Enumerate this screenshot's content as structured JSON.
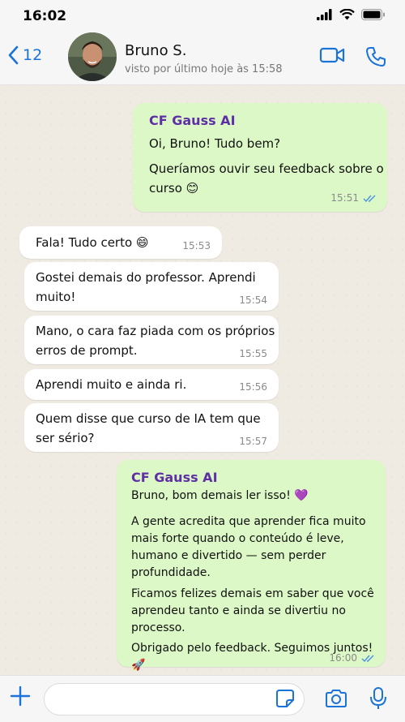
{
  "status_bar": {
    "time": "16:02"
  },
  "header": {
    "back_count": "12",
    "contact_name": "Bruno S.",
    "last_seen": "visto por último hoje às 15:58"
  },
  "messages": [
    {
      "direction": "out",
      "sender": "CF Gauss AI",
      "lines": [
        "Oi, Bruno! Tudo bem?",
        "Queríamos ouvir seu feedback sobre o",
        "curso 😊"
      ],
      "time": "15:51",
      "read": true
    },
    {
      "direction": "in",
      "lines": [
        "Fala! Tudo certo 😄"
      ],
      "time": "15:53"
    },
    {
      "direction": "in",
      "lines": [
        "Gostei demais do professor. Aprendi",
        "muito!"
      ],
      "time": "15:54"
    },
    {
      "direction": "in",
      "lines": [
        "Mano, o cara faz piada com os próprios",
        "erros de prompt."
      ],
      "time": "15:55"
    },
    {
      "direction": "in",
      "lines": [
        "Aprendi muito e ainda ri."
      ],
      "time": "15:56"
    },
    {
      "direction": "in",
      "lines": [
        "Quem disse que curso de IA tem que",
        "ser sério?"
      ],
      "time": "15:57"
    },
    {
      "direction": "out",
      "sender": "CF Gauss AI",
      "lines": [
        "Bruno, bom demais ler isso! 💜",
        "A gente acredita que aprender fica muito",
        "mais forte quando o conteúdo é leve,",
        "humano e divertido — sem perder",
        "profundidade.",
        "Ficamos felizes demais em saber que você",
        "aprendeu tanto e ainda se divertiu no",
        "processo.",
        "Obrigado pelo feedback. Seguimos juntos! 🚀"
      ],
      "time": "16:00",
      "read": true
    }
  ],
  "icons": [
    "back-chevron-icon",
    "video-call-icon",
    "phone-icon",
    "plus-icon",
    "sticker-icon",
    "camera-icon",
    "microphone-icon",
    "double-check-icon"
  ],
  "colors": {
    "accent": "#1a73d9",
    "outgoing_bubble": "#dcf8c6",
    "incoming_bubble": "#ffffff",
    "sender_name": "#5e2fa5",
    "read_ticks": "#4a90e2"
  }
}
